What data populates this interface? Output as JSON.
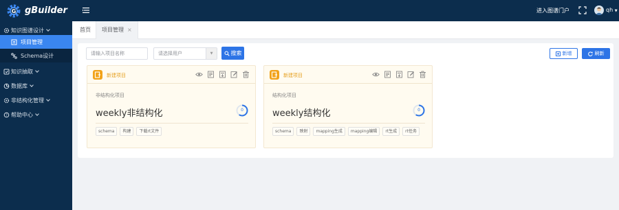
{
  "app": {
    "brand": "gBuilder"
  },
  "topbar": {
    "portal_link": "进入图谱门户",
    "user": "qh"
  },
  "sidebar": {
    "group": {
      "label": "知识图谱设计"
    },
    "subitems": [
      {
        "label": "项目管理",
        "active": true
      },
      {
        "label": "Schema设计",
        "active": false
      }
    ],
    "items": [
      {
        "label": "知识抽取"
      },
      {
        "label": "数据库"
      },
      {
        "label": "非结构化管理"
      },
      {
        "label": "帮助中心"
      }
    ]
  },
  "tabs": {
    "home": "首页",
    "active": "项目管理"
  },
  "toolbar": {
    "project_name_placeholder": "请输入项目名称",
    "user_select_placeholder": "请选择用户",
    "search_label": "搜索",
    "add_label": "新增",
    "refresh_label": "刷新"
  },
  "cards": [
    {
      "header": "新建项目",
      "type": "非结构化项目",
      "title": "weekly非结构化",
      "progress": "0",
      "tags": [
        "schema",
        "构建",
        "下载rt文件"
      ]
    },
    {
      "header": "新建项目",
      "type": "结构化项目",
      "title": "weekly结构化",
      "progress": "0",
      "tags": [
        "schema",
        "映射",
        "mapping生成",
        "mapping编辑",
        "rt生成",
        "rt任务"
      ]
    }
  ],
  "colors": {
    "topbar": "#0c2d4d",
    "accent": "#2d74e6",
    "card_accent": "#f2a31b",
    "card_bg": "#fffbf0"
  }
}
